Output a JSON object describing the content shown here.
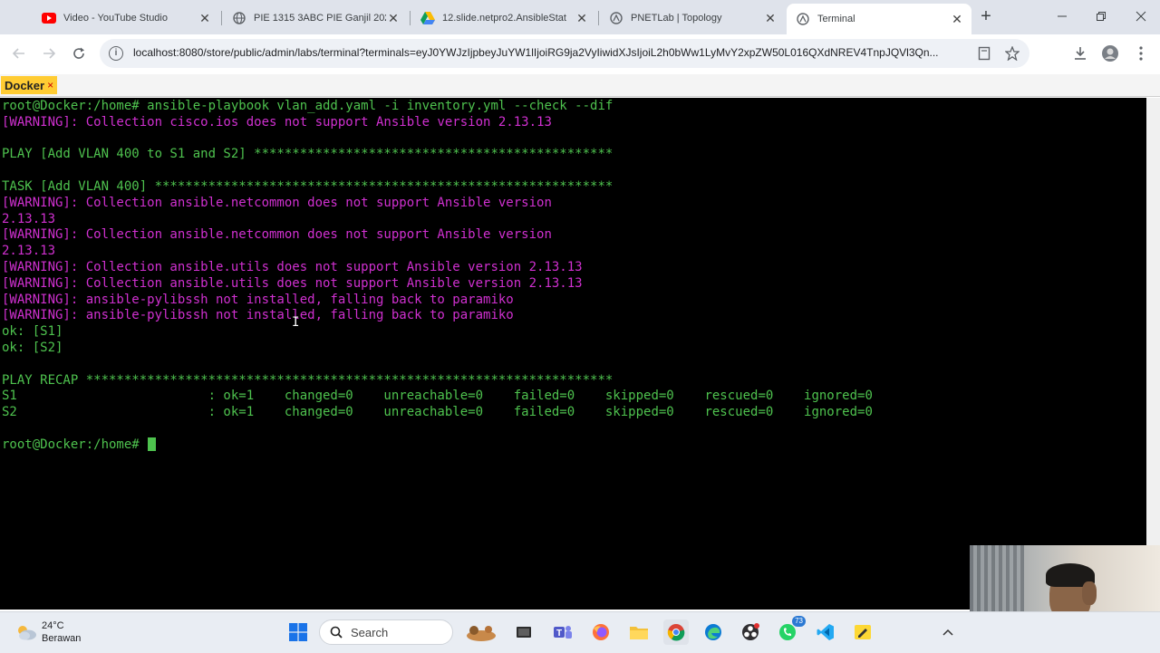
{
  "browser": {
    "tabs": [
      {
        "title": "Video - YouTube Studio",
        "icon": "youtube-icon",
        "active": false
      },
      {
        "title": "PIE 1315 3ABC PIE Ganjil 202",
        "icon": "globe-icon",
        "active": false
      },
      {
        "title": "12.slide.netpro2.AnsibleStat",
        "icon": "google-drive-icon",
        "active": false
      },
      {
        "title": "PNETLab | Topology",
        "icon": "pnetlab-icon",
        "active": false
      },
      {
        "title": "Terminal",
        "icon": "pnetlab-icon",
        "active": true
      }
    ],
    "url": "localhost:8080/store/public/admin/labs/terminal?terminals=eyJ0YWJzIjpbeyJuYW1lIjoiRG9ja2VyIiwidXJsIjoiL2h0bWw1LyMvY2xpZW50L016QXdNREV4TnpJQVl3Qn..."
  },
  "terminal_tab": {
    "label": "Docker",
    "close": "×"
  },
  "terminal": {
    "lines": [
      {
        "text": "root@Docker:/home# ansible-playbook vlan_add.yaml -i inventory.yml --check --dif",
        "color": "green"
      },
      {
        "text": "[WARNING]: Collection cisco.ios does not support Ansible version 2.13.13",
        "color": "magenta"
      },
      {
        "text": "",
        "color": "green"
      },
      {
        "text": "PLAY [Add VLAN 400 to S1 and S2] ***********************************************",
        "color": "green"
      },
      {
        "text": "",
        "color": "green"
      },
      {
        "text": "TASK [Add VLAN 400] ************************************************************",
        "color": "green"
      },
      {
        "text": "[WARNING]: Collection ansible.netcommon does not support Ansible version",
        "color": "magenta"
      },
      {
        "text": "2.13.13",
        "color": "magenta"
      },
      {
        "text": "[WARNING]: Collection ansible.netcommon does not support Ansible version",
        "color": "magenta"
      },
      {
        "text": "2.13.13",
        "color": "magenta"
      },
      {
        "text": "[WARNING]: Collection ansible.utils does not support Ansible version 2.13.13",
        "color": "magenta"
      },
      {
        "text": "[WARNING]: Collection ansible.utils does not support Ansible version 2.13.13",
        "color": "magenta"
      },
      {
        "text": "[WARNING]: ansible-pylibssh not installed, falling back to paramiko",
        "color": "magenta"
      },
      {
        "text": "[WARNING]: ansible-pylibssh not installed, falling back to paramiko",
        "color": "magenta"
      },
      {
        "text": "ok: [S1]",
        "color": "green"
      },
      {
        "text": "ok: [S2]",
        "color": "green"
      },
      {
        "text": "",
        "color": "green"
      },
      {
        "text": "PLAY RECAP *********************************************************************",
        "color": "green"
      },
      {
        "text": "S1                         : ok=1    changed=0    unreachable=0    failed=0    skipped=0    rescued=0    ignored=0",
        "color": "green"
      },
      {
        "text": "S2                         : ok=1    changed=0    unreachable=0    failed=0    skipped=0    rescued=0    ignored=0",
        "color": "green"
      },
      {
        "text": "",
        "color": "green"
      },
      {
        "text": "root@Docker:/home# ",
        "color": "green",
        "cursor": true
      }
    ]
  },
  "taskbar": {
    "weather": {
      "temp": "24°C",
      "desc": "Berawan"
    },
    "search_label": "Search",
    "whatsapp_badge": "73"
  },
  "colors": {
    "terminal_bg": "#000000",
    "terminal_green": "#4ec24e",
    "terminal_magenta": "#d030d0",
    "docker_tab": "#ffcc33"
  }
}
